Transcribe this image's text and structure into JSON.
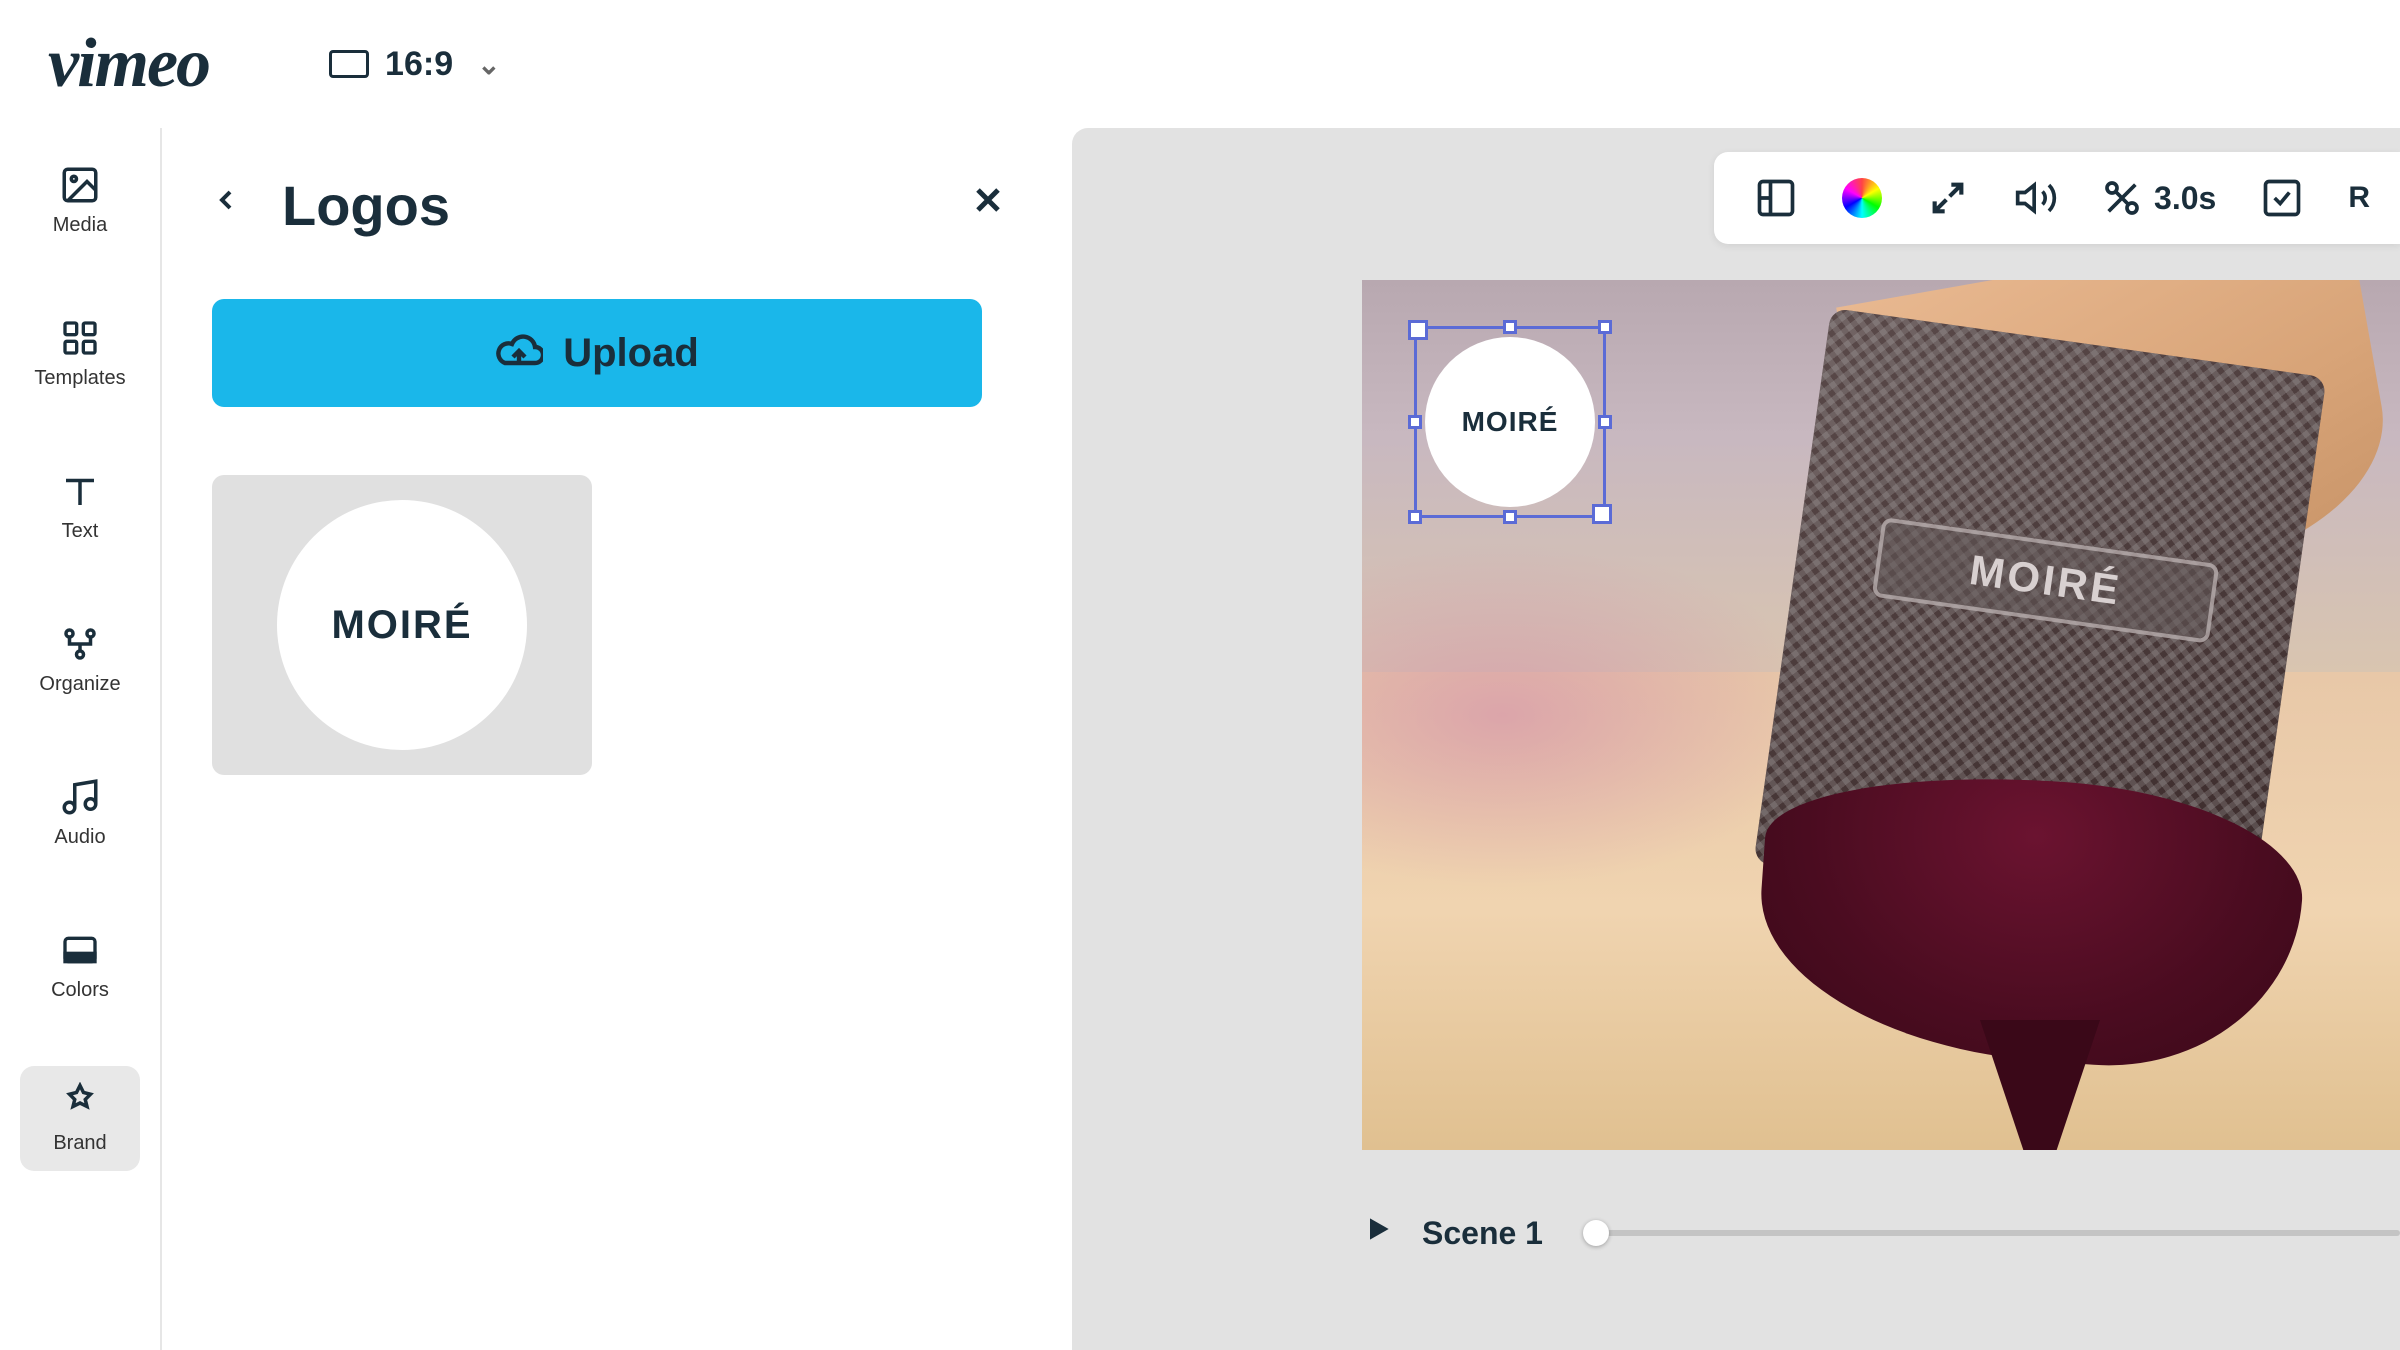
{
  "header": {
    "brand": "vimeo",
    "aspect_ratio": "16:9"
  },
  "sidebar": {
    "items": [
      {
        "label": "Media"
      },
      {
        "label": "Templates"
      },
      {
        "label": "Text"
      },
      {
        "label": "Organize"
      },
      {
        "label": "Audio"
      },
      {
        "label": "Colors"
      },
      {
        "label": "Brand"
      }
    ]
  },
  "panel": {
    "title": "Logos",
    "upload_label": "Upload",
    "logos": [
      {
        "text": "MOIRÉ"
      }
    ]
  },
  "canvas": {
    "toolbar": {
      "duration": "3.0s",
      "replace_label": "R"
    },
    "overlay_logo_text": "MOIRÉ",
    "product_label": "MOIRÉ",
    "scene_label": "Scene 1"
  }
}
